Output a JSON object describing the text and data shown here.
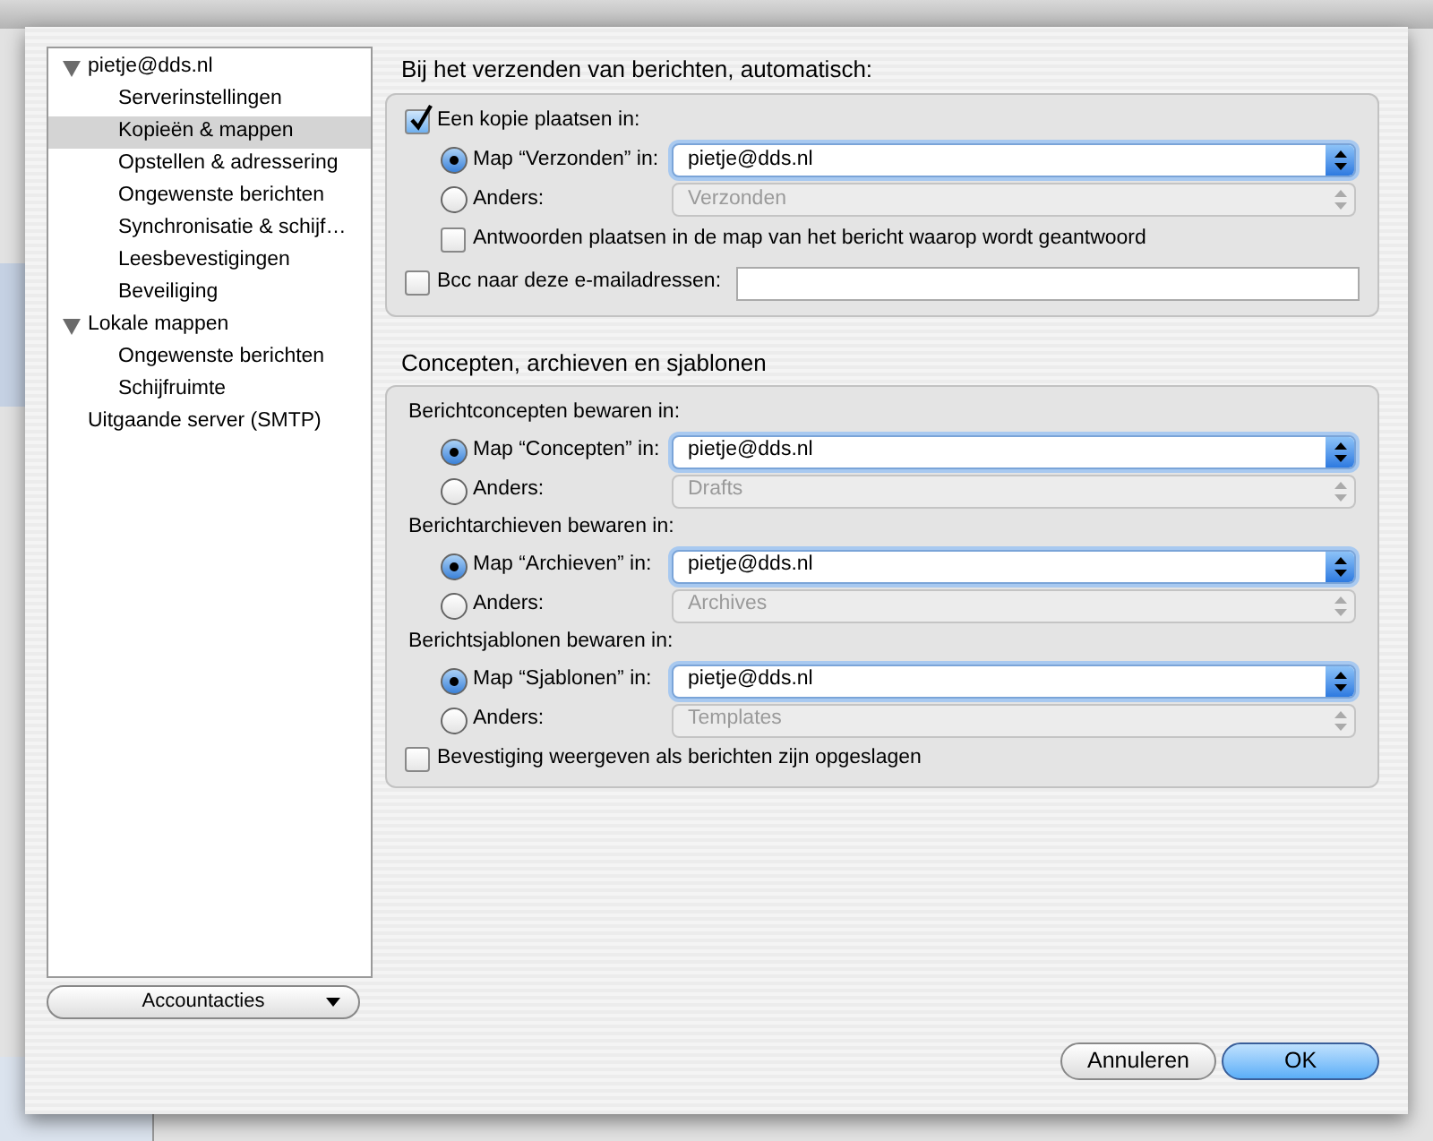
{
  "sidebar": {
    "tree": [
      {
        "label": "pietje@dds.nl",
        "expanded": true,
        "selected": false,
        "children": [
          {
            "label": "Serverinstellingen",
            "selected": false
          },
          {
            "label": "Kopieën & mappen",
            "selected": true
          },
          {
            "label": "Opstellen & adressering",
            "selected": false
          },
          {
            "label": "Ongewenste berichten",
            "selected": false
          },
          {
            "label": "Synchronisatie & schijf…",
            "selected": false
          },
          {
            "label": "Leesbevestigingen",
            "selected": false
          },
          {
            "label": "Beveiliging",
            "selected": false
          }
        ]
      },
      {
        "label": "Lokale mappen",
        "expanded": true,
        "selected": false,
        "children": [
          {
            "label": "Ongewenste berichten",
            "selected": false
          },
          {
            "label": "Schijfruimte",
            "selected": false
          }
        ]
      },
      {
        "label": "Uitgaande server (SMTP)",
        "selected": false
      }
    ]
  },
  "account_actions": {
    "label": "Accountacties"
  },
  "sections": [
    {
      "title": "Bij het verzenden van berichten, automatisch:",
      "rows": [
        {
          "kind": "checkbox",
          "label": "Een kopie plaatsen in:",
          "checked": true
        },
        {
          "kind": "radio",
          "label": "Map “Verzonden” in:",
          "selected": true,
          "value": "pietje@dds.nl",
          "disabled": false
        },
        {
          "kind": "radio",
          "label": "Anders:",
          "selected": false,
          "value": "Verzonden",
          "disabled": true
        },
        {
          "kind": "subcheckbox",
          "label": "Antwoorden plaatsen in de map van het bericht waarop wordt geantwoord",
          "checked": false
        },
        {
          "kind": "checkfield",
          "label": "Bcc naar deze e-mailadressen:",
          "checked": false
        }
      ]
    },
    {
      "title": "Concepten, archieven en sjablonen",
      "rows": [
        {
          "kind": "heading",
          "label": "Berichtconcepten bewaren in:"
        },
        {
          "kind": "radio",
          "label": "Map “Concepten” in:",
          "selected": true,
          "value": "pietje@dds.nl",
          "disabled": false
        },
        {
          "kind": "radio",
          "label": "Anders:",
          "selected": false,
          "value": "Drafts",
          "disabled": true
        },
        {
          "kind": "heading",
          "label": "Berichtarchieven bewaren in:"
        },
        {
          "kind": "radio",
          "label": "Map “Archieven” in:",
          "selected": true,
          "value": "pietje@dds.nl",
          "disabled": false
        },
        {
          "kind": "radio",
          "label": "Anders:",
          "selected": false,
          "value": "Archives",
          "disabled": true
        },
        {
          "kind": "heading",
          "label": "Berichtsjablonen bewaren in:"
        },
        {
          "kind": "radio",
          "label": "Map “Sjablonen” in:",
          "selected": true,
          "value": "pietje@dds.nl",
          "disabled": false
        },
        {
          "kind": "radio",
          "label": "Anders:",
          "selected": false,
          "value": "Templates",
          "disabled": true
        },
        {
          "kind": "checkbox",
          "label": "Bevestiging weergeven als berichten zijn opgeslagen",
          "checked": false
        }
      ]
    }
  ],
  "buttons": [
    {
      "label": "Annuleren",
      "primary": false
    },
    {
      "label": "OK",
      "primary": true
    }
  ]
}
